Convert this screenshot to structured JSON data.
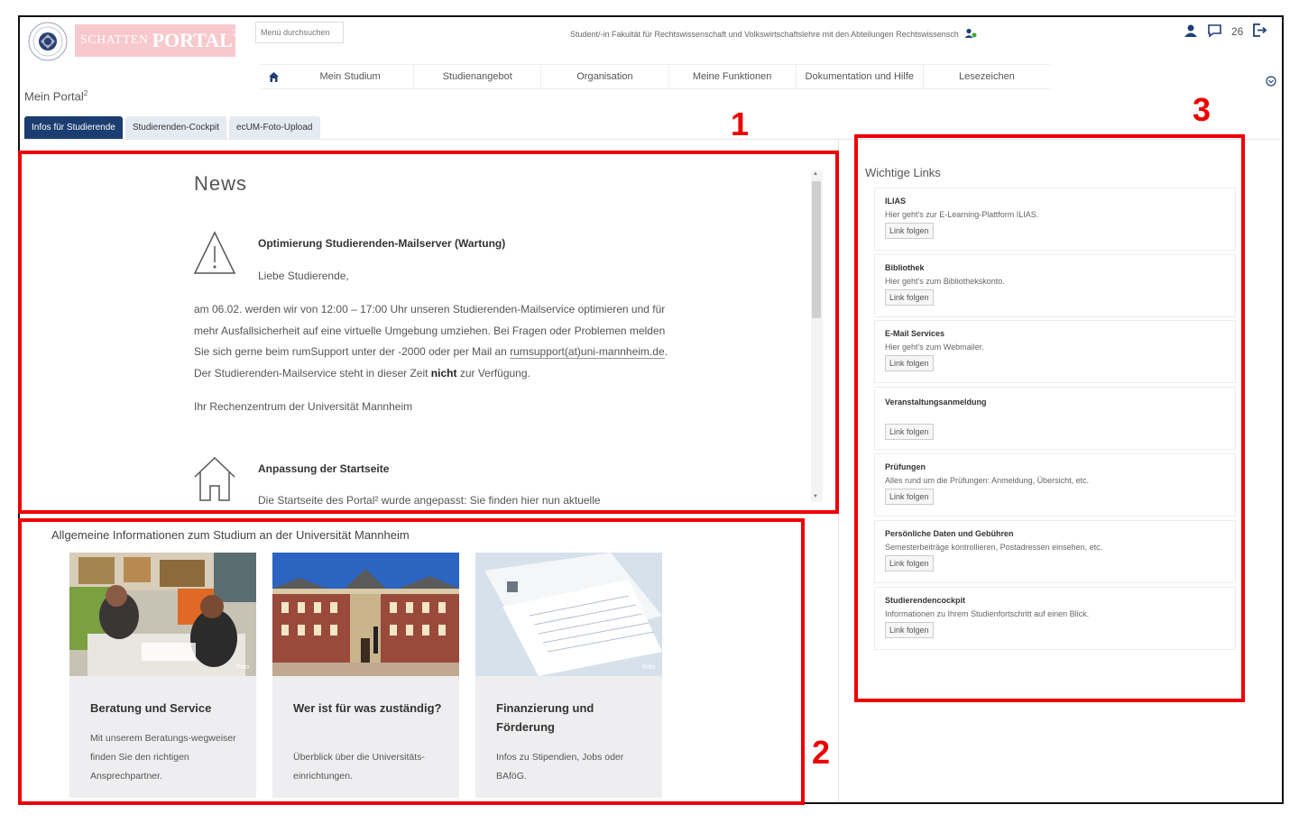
{
  "header": {
    "brand_part1": "SCHATTEN",
    "brand_part2": "PORTAL",
    "brand_sup": "2",
    "menu_search_placeholder": "Menü durchsuchen",
    "role_text": "Student/-in Fakultät für Rechtswissenschaft und Volkswirtschaftslehre mit den Abteilungen Rechtswissensch",
    "message_count": "26"
  },
  "nav": {
    "items": [
      "Mein Studium",
      "Studienangebot",
      "Organisation",
      "Meine Funktionen",
      "Dokumentation und Hilfe",
      "Lesezeichen"
    ]
  },
  "page": {
    "title": "Mein Portal",
    "title_sup": "2"
  },
  "tabs": [
    "Infos für Studierende",
    "Studierenden-Cockpit",
    "ecUM-Foto-Upload"
  ],
  "news": {
    "title": "News",
    "item1": {
      "heading": "Optimierung Studierenden-Mailserver (Wartung)",
      "salutation": "Liebe Studierende,",
      "body_a": "am 06.02. werden wir von 12:00 – 17:00 Uhr unseren Studierenden-Mailservice optimieren und für mehr Ausfallsicherheit auf eine virtuelle Umgebung umziehen. Bei Fragen oder Problemen melden Sie sich gerne beim rumSupport unter der -2000 oder per Mail an",
      "body_link": "rumsupport(at)uni-mannheim.de",
      "body_b": ". Der Studierenden-Mailservice steht in dieser Zeit",
      "body_bold": "nicht",
      "body_c": "zur Verfügung.",
      "signature": "Ihr Rechenzentrum der Universität Mannheim"
    },
    "item2": {
      "heading": "Anpassung der Startseite",
      "body": "Die Startseite des Portal² wurde angepasst: Sie finden hier nun aktuelle"
    }
  },
  "general": {
    "title": "Allgemeine Informationen zum Studium an der Universität Mannheim",
    "cards": [
      {
        "title": "Beratung und Service",
        "text": "Mit unserem Beratungs-wegweiser finden Sie den richtigen Ansprechpartner.",
        "credit": "Foto"
      },
      {
        "title": "Wer ist für was zuständig?",
        "text": "Überblick über die Universitäts-einrichtungen.",
        "credit": ""
      },
      {
        "title": "Finanzierung und Förderung",
        "text": "Infos zu Stipendien, Jobs oder BAföG.",
        "credit": "Foto"
      }
    ]
  },
  "links": {
    "title": "Wichtige Links",
    "button_label": "Link folgen",
    "items": [
      {
        "title": "ILIAS",
        "desc": "Hier geht's zur E-Learning-Plattform ILIAS."
      },
      {
        "title": "Bibliothek",
        "desc": "Hier geht's zum Bibliothekskonto."
      },
      {
        "title": "E-Mail Services",
        "desc": "Hier geht's zum Webmailer."
      },
      {
        "title": "Veranstaltungsanmeldung",
        "desc": ""
      },
      {
        "title": "Prüfungen",
        "desc": "Alles rund um die Prüfungen: Anmeldung, Übersicht, etc."
      },
      {
        "title": "Persönliche Daten und Gebühren",
        "desc": "Semesterbeiträge kontrollieren, Postadressen einsehen, etc."
      },
      {
        "title": "Studierendencockpit",
        "desc": "Informationen zu Ihrem Studienfortschritt auf einen Blick."
      }
    ]
  },
  "annotations": [
    "1",
    "2",
    "3"
  ],
  "colors": {
    "accent": "#1c3d70",
    "annotation": "#ee0000",
    "brand_bg": "#f7c8cc"
  }
}
